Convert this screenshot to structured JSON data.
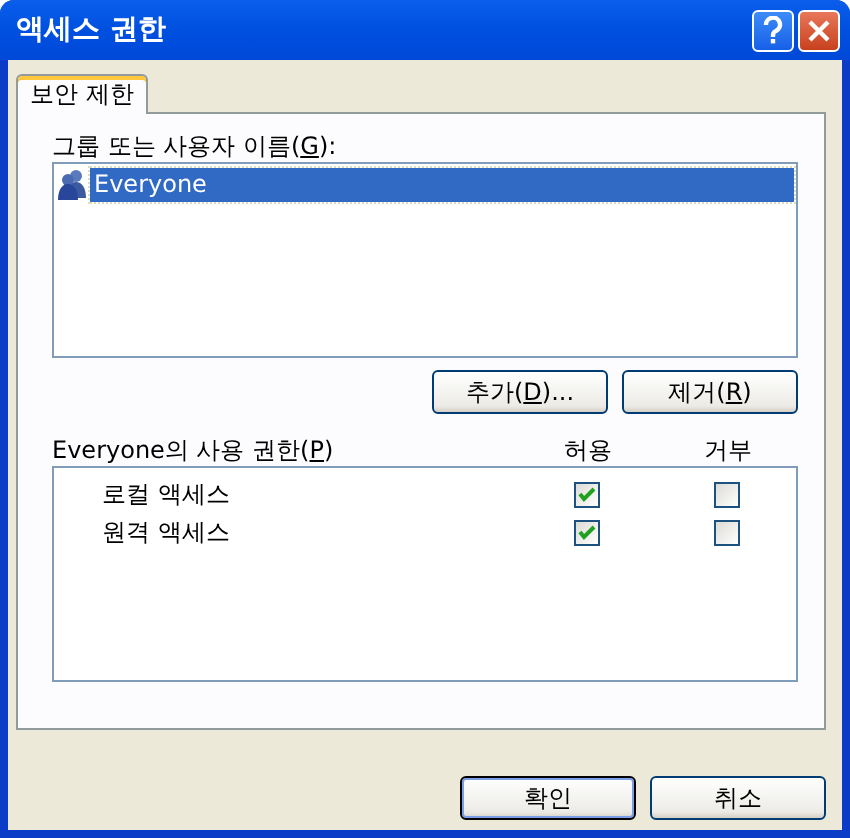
{
  "window": {
    "title": "액세스 권한"
  },
  "tabs": [
    {
      "label": "보안 제한",
      "selected": true
    }
  ],
  "group_label": {
    "before": "그룹 또는 사용자 이름(",
    "key": "G",
    "after": "):"
  },
  "users": [
    {
      "name": "Everyone",
      "selected": true
    }
  ],
  "user_buttons": [
    {
      "before": "추가(",
      "key": "D",
      "after": ")..."
    },
    {
      "before": "제거(",
      "key": "R",
      "after": ")"
    }
  ],
  "permissions_label": {
    "before": "Everyone의 사용 권한(",
    "key": "P",
    "after": ")"
  },
  "columns": [
    "허용",
    "거부"
  ],
  "permissions": [
    {
      "name": "로컬 액세스",
      "allow": true,
      "deny": false
    },
    {
      "name": "원격 액세스",
      "allow": true,
      "deny": false
    }
  ],
  "buttons": [
    {
      "label": "확인",
      "default": true
    },
    {
      "label": "취소",
      "default": false
    }
  ]
}
